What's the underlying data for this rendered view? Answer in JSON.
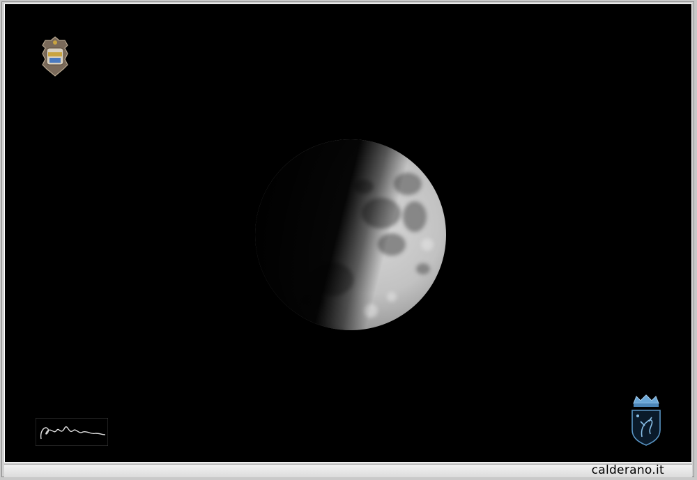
{
  "caption": {
    "site": "calderano.it"
  },
  "photo": {
    "subject": "moon",
    "background_color": "#000000"
  },
  "watermarks": {
    "top_left": "coat-of-arms-icon",
    "bottom_left": "signature-icon",
    "bottom_right": "crest-icon"
  }
}
